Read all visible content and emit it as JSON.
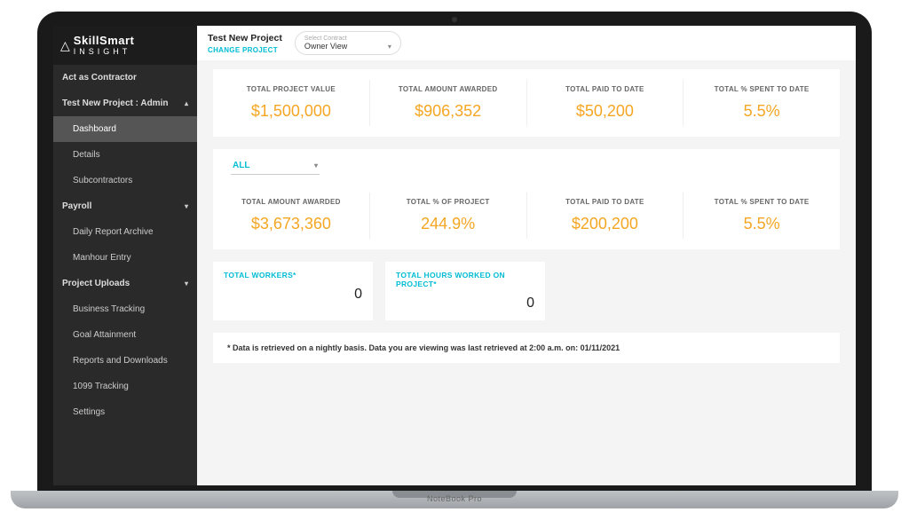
{
  "brand": {
    "top": "SkillSmart",
    "bottom": "INSIGHT"
  },
  "sidebar": {
    "act_as": "Act as Contractor",
    "project_header": "Test New Project : Admin",
    "items": {
      "dashboard": "Dashboard",
      "details": "Details",
      "subcontractors": "Subcontractors",
      "payroll": "Payroll",
      "daily_report": "Daily Report Archive",
      "manhour": "Manhour Entry",
      "project_uploads": "Project Uploads",
      "business_tracking": "Business Tracking",
      "goal": "Goal Attainment",
      "reports": "Reports and Downloads",
      "tracking_1099": "1099 Tracking",
      "settings": "Settings"
    }
  },
  "topbar": {
    "project_name": "Test New Project",
    "change_project": "CHANGE PROJECT",
    "contract_label": "Select Contract",
    "contract_value": "Owner View"
  },
  "metrics_top": [
    {
      "label": "TOTAL PROJECT VALUE",
      "value": "$1,500,000"
    },
    {
      "label": "TOTAL AMOUNT AWARDED",
      "value": "$906,352"
    },
    {
      "label": "TOTAL PAID TO DATE",
      "value": "$50,200"
    },
    {
      "label": "TOTAL % SPENT TO DATE",
      "value": "5.5%"
    }
  ],
  "filter": {
    "value": "ALL"
  },
  "metrics_mid": [
    {
      "label": "TOTAL AMOUNT AWARDED",
      "value": "$3,673,360"
    },
    {
      "label": "TOTAL % OF PROJECT",
      "value": "244.9%"
    },
    {
      "label": "TOTAL PAID TO DATE",
      "value": "$200,200"
    },
    {
      "label": "TOTAL % SPENT TO DATE",
      "value": "5.5%"
    }
  ],
  "small_cards": [
    {
      "label": "TOTAL WORKERS*",
      "value": "0"
    },
    {
      "label": "TOTAL HOURS WORKED ON PROJECT*",
      "value": "0"
    }
  ],
  "footnote": "* Data is retrieved on a nightly basis. Data you are viewing was last retrieved at 2:00 a.m. on: 01/11/2021",
  "device": "NoteBook Pro"
}
